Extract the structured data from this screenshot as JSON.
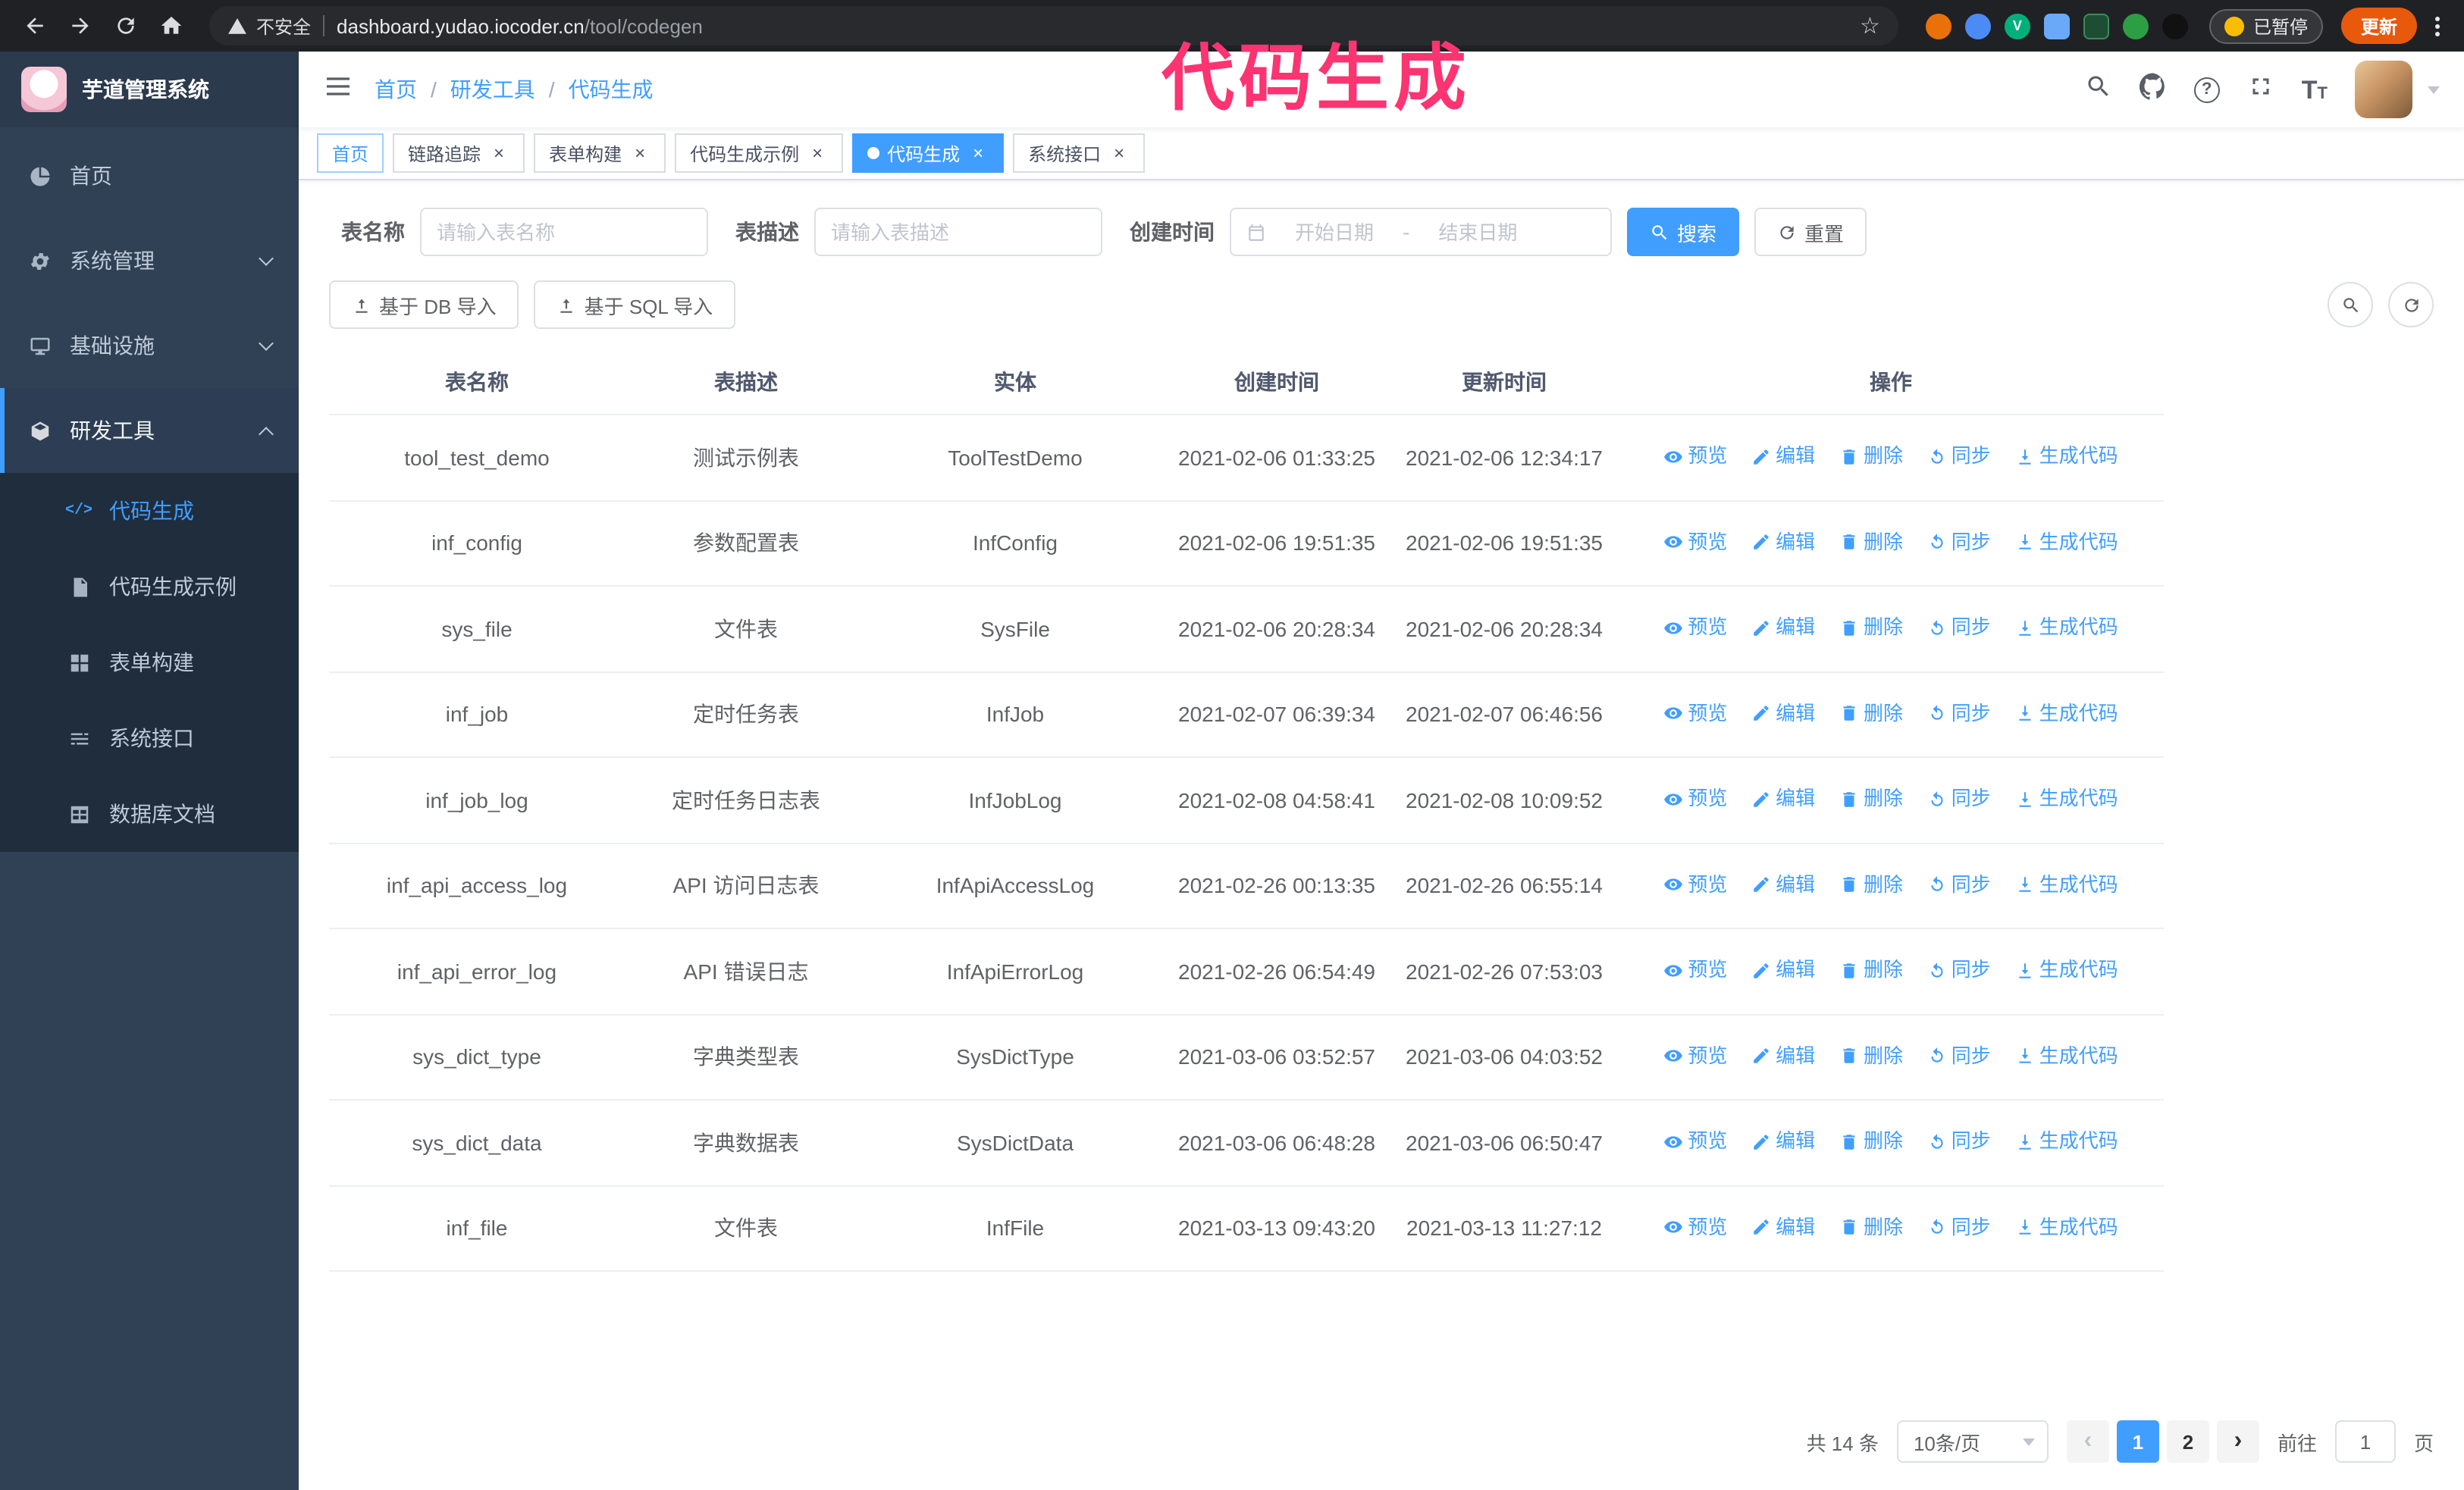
{
  "annotation": {
    "text": "代码生成",
    "color": "#fc3472"
  },
  "browser": {
    "security_label": "不安全",
    "url_host": "dashboard.yudao.iocoder.cn",
    "url_path": "/tool/codegen",
    "paused_badge": "已暂停",
    "update_label": "更新"
  },
  "sidebar": {
    "logo_title": "芋道管理系统",
    "items": [
      {
        "label": "首页",
        "icon": "dashboard-icon"
      },
      {
        "label": "系统管理",
        "icon": "gear-icon",
        "expandable": true
      },
      {
        "label": "基础设施",
        "icon": "infrastructure-icon",
        "expandable": true
      },
      {
        "label": "研发工具",
        "icon": "tools-icon",
        "expandable": true,
        "expanded": true
      }
    ],
    "subitems": [
      {
        "label": "代码生成",
        "icon": "code-icon",
        "active": true
      },
      {
        "label": "代码生成示例",
        "icon": "example-icon"
      },
      {
        "label": "表单构建",
        "icon": "form-icon"
      },
      {
        "label": "系统接口",
        "icon": "api-icon"
      },
      {
        "label": "数据库文档",
        "icon": "database-icon"
      }
    ]
  },
  "navbar": {
    "breadcrumb": [
      "首页",
      "研发工具",
      "代码生成"
    ]
  },
  "tabs": [
    {
      "label": "首页",
      "closable": false,
      "active": false
    },
    {
      "label": "链路追踪",
      "closable": true,
      "active": false
    },
    {
      "label": "表单构建",
      "closable": true,
      "active": false
    },
    {
      "label": "代码生成示例",
      "closable": true,
      "active": false
    },
    {
      "label": "代码生成",
      "closable": true,
      "active": true
    },
    {
      "label": "系统接口",
      "closable": true,
      "active": false
    }
  ],
  "filters": {
    "name_label": "表名称",
    "name_placeholder": "请输入表名称",
    "desc_label": "表描述",
    "desc_placeholder": "请输入表描述",
    "time_label": "创建时间",
    "start_placeholder": "开始日期",
    "end_placeholder": "结束日期",
    "range_separator": "-",
    "search_label": "搜索",
    "reset_label": "重置"
  },
  "toolbar": {
    "import_db_label": "基于 DB 导入",
    "import_sql_label": "基于 SQL 导入"
  },
  "table": {
    "headers": [
      "表名称",
      "表描述",
      "实体",
      "创建时间",
      "更新时间",
      "操作"
    ],
    "ops": [
      "预览",
      "编辑",
      "删除",
      "同步",
      "生成代码"
    ],
    "rows": [
      {
        "name": "tool_test_demo",
        "desc": "测试示例表",
        "entity": "ToolTestDemo",
        "created": "2021-02-06 01:33:25",
        "updated": "2021-02-06 12:34:17"
      },
      {
        "name": "inf_config",
        "desc": "参数配置表",
        "entity": "InfConfig",
        "created": "2021-02-06 19:51:35",
        "updated": "2021-02-06 19:51:35"
      },
      {
        "name": "sys_file",
        "desc": "文件表",
        "entity": "SysFile",
        "created": "2021-02-06 20:28:34",
        "updated": "2021-02-06 20:28:34"
      },
      {
        "name": "inf_job",
        "desc": "定时任务表",
        "entity": "InfJob",
        "created": "2021-02-07 06:39:34",
        "updated": "2021-02-07 06:46:56"
      },
      {
        "name": "inf_job_log",
        "desc": "定时任务日志表",
        "entity": "InfJobLog",
        "created": "2021-02-08 04:58:41",
        "updated": "2021-02-08 10:09:52"
      },
      {
        "name": "inf_api_access_log",
        "desc": "API 访问日志表",
        "entity": "InfApiAccessLog",
        "created": "2021-02-26 00:13:35",
        "updated": "2021-02-26 06:55:14"
      },
      {
        "name": "inf_api_error_log",
        "desc": "API 错误日志",
        "entity": "InfApiErrorLog",
        "created": "2021-02-26 06:54:49",
        "updated": "2021-02-26 07:53:03"
      },
      {
        "name": "sys_dict_type",
        "desc": "字典类型表",
        "entity": "SysDictType",
        "created": "2021-03-06 03:52:57",
        "updated": "2021-03-06 04:03:52"
      },
      {
        "name": "sys_dict_data",
        "desc": "字典数据表",
        "entity": "SysDictData",
        "created": "2021-03-06 06:48:28",
        "updated": "2021-03-06 06:50:47"
      },
      {
        "name": "inf_file",
        "desc": "文件表",
        "entity": "InfFile",
        "created": "2021-03-13 09:43:20",
        "updated": "2021-03-13 11:27:12"
      }
    ]
  },
  "pagination": {
    "total_label": "共 14 条",
    "page_size_label": "10条/页",
    "pages": [
      "1",
      "2"
    ],
    "active_page": "1",
    "goto_label": "前往",
    "goto_value": "1",
    "page_label": "页"
  },
  "colors": {
    "accent": "#409eff",
    "sidebar_bg": "#304156",
    "submenu_bg": "#1f2d3d",
    "annotation": "#fc3472",
    "update_button": "#e8590c"
  }
}
